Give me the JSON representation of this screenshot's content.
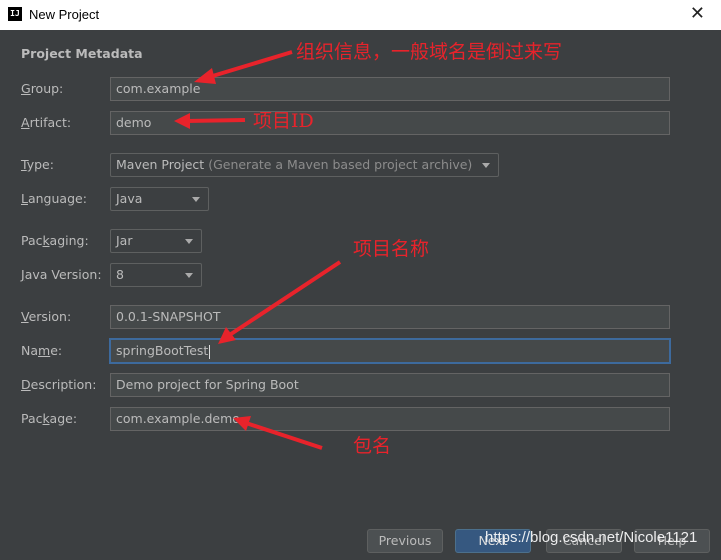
{
  "window": {
    "icon_text": "IJ",
    "title": "New Project",
    "close_glyph": "✕"
  },
  "section_title": "Project Metadata",
  "fields": {
    "group": {
      "label_mnemonic": "G",
      "label_rest": "roup:",
      "value": "com.example"
    },
    "artifact": {
      "label_mnemonic": "A",
      "label_rest": "rtifact:",
      "value": "demo"
    },
    "type": {
      "label_mnemonic": "T",
      "label_rest": "ype:",
      "value": "Maven Project",
      "hint": "(Generate a Maven based project archive)"
    },
    "language": {
      "label_mnemonic": "L",
      "label_rest": "anguage:",
      "value": "Java"
    },
    "packaging": {
      "label_pre": "Pac",
      "label_mnemonic": "k",
      "label_rest": "aging:",
      "value": "Jar"
    },
    "java_version": {
      "label_mnemonic": "J",
      "label_rest": "ava Version:",
      "value": "8"
    },
    "version": {
      "label_mnemonic": "V",
      "label_rest": "ersion:",
      "value": "0.0.1-SNAPSHOT"
    },
    "name": {
      "label_pre": "Na",
      "label_mnemonic": "m",
      "label_rest": "e:",
      "value": "springBootTest"
    },
    "description": {
      "label_mnemonic": "D",
      "label_rest": "escription:",
      "value": "Demo project for Spring Boot"
    },
    "package": {
      "label_pre": "Pac",
      "label_mnemonic": "k",
      "label_rest": "age:",
      "value": "com.example.demo"
    }
  },
  "buttons": {
    "previous": "Previous",
    "next": "Next",
    "cancel": "Cancel",
    "help": "Help"
  },
  "annotations": {
    "group_note": "组织信息，一般域名是倒过来写",
    "artifact_note": "项目ID",
    "name_note": "项目名称",
    "package_note": "包名"
  },
  "watermark": "https://blog.csdn.net/Nicole1121",
  "colors": {
    "annotation": "#e8232b",
    "background": "#3c3f41",
    "focus": "#3d6a9d"
  }
}
